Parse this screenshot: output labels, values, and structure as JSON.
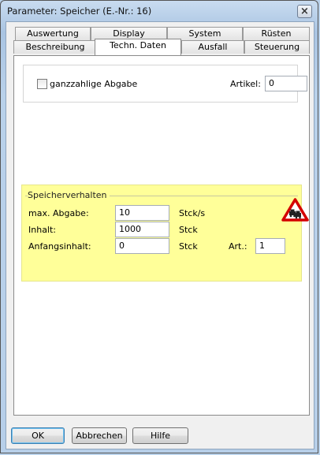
{
  "window": {
    "title": "Parameter: Speicher (E.-Nr.:  16)",
    "close_glyph": "×"
  },
  "tabs": {
    "row_top": [
      "Auswertung",
      "Display",
      "System",
      "Rüsten"
    ],
    "row_bottom": [
      "Beschreibung",
      "Techn. Daten",
      "Ausfall",
      "Steuerung"
    ],
    "active": "Techn. Daten"
  },
  "general": {
    "ganzzahlig_label": "ganzzahlige Abgabe",
    "ganzzahlig_checked": false,
    "artikel_label": "Artikel:",
    "artikel_value": "0"
  },
  "speicherverhalten": {
    "group_label": "Speicherverhalten",
    "rows": [
      {
        "label": "max. Abgabe:",
        "value": "10",
        "unit": "Stck/s"
      },
      {
        "label": "Inhalt:",
        "value": "1000",
        "unit": "Stck"
      },
      {
        "label": "Anfangsinhalt:",
        "value": "0",
        "unit": "Stck"
      }
    ],
    "art_label": "Art.:",
    "art_value": "1",
    "icon": "traffic-jam-warning-icon"
  },
  "buttons": {
    "ok": "OK",
    "cancel": "Abbrechen",
    "help": "Hilfe"
  },
  "colors": {
    "group_background": "#ffff99",
    "warning_red": "#d40000"
  }
}
